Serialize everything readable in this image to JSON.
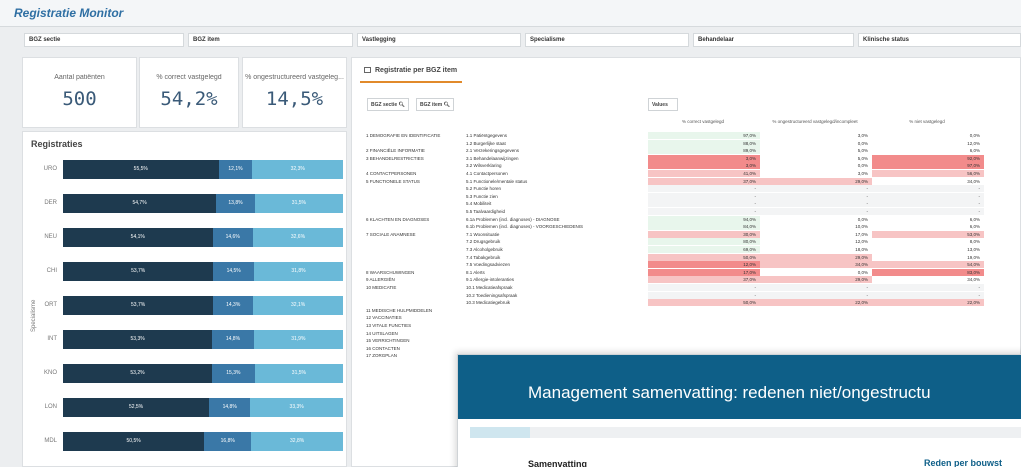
{
  "app": {
    "title": "Registratie Monitor"
  },
  "filters": [
    "BGZ sectie",
    "BGZ item",
    "Vastlegging",
    "Specialisme",
    "Behandelaar",
    "Klinische status"
  ],
  "kpis": [
    {
      "label": "Aantal patiënten",
      "value": "500"
    },
    {
      "label": "% correct vastgelegd",
      "value": "54,2%"
    },
    {
      "label": "% ongestructureerd vastgeleg...",
      "value": "14,5%"
    }
  ],
  "registraties": {
    "title": "Registraties",
    "axis_label": "Specialisme",
    "rows": [
      {
        "cat": "URO",
        "v1": "55,5%",
        "v2": "12,1%",
        "v3": "32,3%"
      },
      {
        "cat": "DER",
        "v1": "54,7%",
        "v2": "13,8%",
        "v3": "31,5%"
      },
      {
        "cat": "NEU",
        "v1": "54,1%",
        "v2": "14,6%",
        "v3": "32,6%"
      },
      {
        "cat": "CHI",
        "v1": "53,7%",
        "v2": "14,5%",
        "v3": "31,8%"
      },
      {
        "cat": "ORT",
        "v1": "53,7%",
        "v2": "14,3%",
        "v3": "32,1%"
      },
      {
        "cat": "INT",
        "v1": "53,3%",
        "v2": "14,8%",
        "v3": "31,9%"
      },
      {
        "cat": "KNO",
        "v1": "53,2%",
        "v2": "15,3%",
        "v3": "31,5%"
      },
      {
        "cat": "LON",
        "v1": "52,5%",
        "v2": "14,8%",
        "v3": "33,3%"
      },
      {
        "cat": "MDL",
        "v1": "50,5%",
        "v2": "16,8%",
        "v3": "32,8%"
      }
    ]
  },
  "table": {
    "tab_title": "Registratie per BGZ item",
    "dim_buttons": [
      "BGZ sectie",
      "BGZ item"
    ],
    "values_label": "Values",
    "col_headers": [
      "% correct vastgelegd",
      "% ongestructureerd vastgelegd/incompleet",
      "% niet vastgelegd"
    ],
    "rows": [
      {
        "s": "1 DEMOGRAFIE EN IDENTIFICATIE",
        "i": "1.1 Patiëntgegevens",
        "a": "97,0%",
        "b": "3,0%",
        "c": "0,0%",
        "ca": "#e8f6ec",
        "cb": "#ffffff",
        "cc": "#ffffff"
      },
      {
        "s": "",
        "i": "1.2 Burgerlijke staat",
        "a": "88,0%",
        "b": "0,0%",
        "c": "12,0%",
        "ca": "#e8f6ec",
        "cb": "#ffffff",
        "cc": "#ffffff"
      },
      {
        "s": "2 FINANCIËLE INFORMATIE",
        "i": "2.1 Verzekeringsgegevens",
        "a": "89,0%",
        "b": "5,0%",
        "c": "6,0%",
        "ca": "#e8f6ec",
        "cb": "#ffffff",
        "cc": "#ffffff"
      },
      {
        "s": "3 BEHANDELRESTRICTIES",
        "i": "3.1 Behandelaanwijzingen",
        "a": "3,0%",
        "b": "5,0%",
        "c": "92,0%",
        "ca": "#f28b8b",
        "cb": "#ffffff",
        "cc": "#f28b8b"
      },
      {
        "s": "",
        "i": "3.2 Wilsverklaring",
        "a": "3,0%",
        "b": "0,0%",
        "c": "97,0%",
        "ca": "#f28b8b",
        "cb": "#ffffff",
        "cc": "#f28b8b"
      },
      {
        "s": "4 CONTACTPERSONEN",
        "i": "4.1 Contactpersonen",
        "a": "41,0%",
        "b": "3,0%",
        "c": "56,0%",
        "ca": "#f7c4c4",
        "cb": "#ffffff",
        "cc": "#f7c4c4"
      },
      {
        "s": "5 FUNCTIONELE STATUS",
        "i": "5.1 Functionele/mentale status",
        "a": "37,0%",
        "b": "29,0%",
        "c": "34,0%",
        "ca": "#f7c4c4",
        "cb": "#f7c4c4",
        "cc": "#ffffff"
      },
      {
        "s": "",
        "i": "5.2 Functie horen",
        "a": "-",
        "b": "-",
        "c": "-",
        "ca": "#f3f4f5",
        "cb": "#f3f4f5",
        "cc": "#f3f4f5"
      },
      {
        "s": "",
        "i": "5.3 Functie zien",
        "a": "-",
        "b": "-",
        "c": "-",
        "ca": "#f3f4f5",
        "cb": "#f3f4f5",
        "cc": "#f3f4f5"
      },
      {
        "s": "",
        "i": "5.4 Mobiliteit",
        "a": "-",
        "b": "-",
        "c": "-",
        "ca": "#f3f4f5",
        "cb": "#f3f4f5",
        "cc": "#f3f4f5"
      },
      {
        "s": "",
        "i": "5.5 Taalvaardigheid",
        "a": "-",
        "b": "-",
        "c": "-",
        "ca": "#f3f4f5",
        "cb": "#f3f4f5",
        "cc": "#f3f4f5"
      },
      {
        "s": "6 KLACHTEN EN DIAGNOSES",
        "i": "6.1a Problemen (incl. diagnoses) - DIAGNOSE",
        "a": "94,0%",
        "b": "0,0%",
        "c": "6,0%",
        "ca": "#e8f6ec",
        "cb": "#ffffff",
        "cc": "#ffffff"
      },
      {
        "s": "",
        "i": "6.1b Problemen (incl. diagnoses) - VOORGESCHIEDENIS",
        "a": "84,0%",
        "b": "10,0%",
        "c": "6,0%",
        "ca": "#e8f6ec",
        "cb": "#ffffff",
        "cc": "#ffffff"
      },
      {
        "s": "7 SOCIALE ANAMNESE",
        "i": "7.1 Woonsituatie",
        "a": "30,0%",
        "b": "17,0%",
        "c": "53,0%",
        "ca": "#f7c4c4",
        "cb": "#ffffff",
        "cc": "#f7c4c4"
      },
      {
        "s": "",
        "i": "7.2 Drugsgebruik",
        "a": "80,0%",
        "b": "12,0%",
        "c": "8,0%",
        "ca": "#e8f6ec",
        "cb": "#ffffff",
        "cc": "#ffffff"
      },
      {
        "s": "",
        "i": "7.3 Alcoholgebruik",
        "a": "69,0%",
        "b": "18,0%",
        "c": "13,0%",
        "ca": "#e8f6ec",
        "cb": "#ffffff",
        "cc": "#ffffff"
      },
      {
        "s": "",
        "i": "7.4 Tabakgebruik",
        "a": "50,0%",
        "b": "29,0%",
        "c": "19,0%",
        "ca": "#f7c4c4",
        "cb": "#f7c4c4",
        "cc": "#ffffff"
      },
      {
        "s": "",
        "i": "7.5 Voedingsadviezen",
        "a": "12,0%",
        "b": "34,0%",
        "c": "54,0%",
        "ca": "#f28b8b",
        "cb": "#f7c4c4",
        "cc": "#f7c4c4"
      },
      {
        "s": "8 WAARSCHUWINGEN",
        "i": "8.1 Alerts",
        "a": "17,0%",
        "b": "0,0%",
        "c": "83,0%",
        "ca": "#f28b8b",
        "cb": "#ffffff",
        "cc": "#f28b8b"
      },
      {
        "s": "9 ALLERGIËN",
        "i": "9.1 Allergie-intoleranties",
        "a": "37,0%",
        "b": "29,0%",
        "c": "34,0%",
        "ca": "#f7c4c4",
        "cb": "#f7c4c4",
        "cc": "#ffffff"
      },
      {
        "s": "10 MEDICATIE",
        "i": "10.1 Medicatieafspraak",
        "a": "-",
        "b": "-",
        "c": "-",
        "ca": "#f3f4f5",
        "cb": "#f3f4f5",
        "cc": "#f3f4f5"
      },
      {
        "s": "",
        "i": "10.2 Toedieningsafspraak",
        "a": "-",
        "b": "-",
        "c": "-",
        "ca": "#f3f4f5",
        "cb": "#f3f4f5",
        "cc": "#f3f4f5"
      },
      {
        "s": "",
        "i": "10.3 Medicatiegebruik",
        "a": "50,0%",
        "b": "22,0%",
        "c": "22,0%",
        "ca": "#f7c4c4",
        "cb": "#f7c4c4",
        "cc": "#f7c4c4"
      },
      {
        "s": "11 MEDISCHE HULPMIDDELEN",
        "i": "",
        "a": "",
        "b": "",
        "c": "",
        "ca": "#ffffff",
        "cb": "#ffffff",
        "cc": "#ffffff"
      },
      {
        "s": "12 VACCINATIES",
        "i": "",
        "a": "",
        "b": "",
        "c": "",
        "ca": "#ffffff",
        "cb": "#ffffff",
        "cc": "#ffffff"
      },
      {
        "s": "13 VITALE FUNCTIES",
        "i": "",
        "a": "",
        "b": "",
        "c": "",
        "ca": "#ffffff",
        "cb": "#ffffff",
        "cc": "#ffffff"
      },
      {
        "s": "14 UITSLAGEN",
        "i": "",
        "a": "",
        "b": "",
        "c": "",
        "ca": "#ffffff",
        "cb": "#ffffff",
        "cc": "#ffffff"
      },
      {
        "s": "15 VERRICHTINGEN",
        "i": "",
        "a": "",
        "b": "",
        "c": "",
        "ca": "#ffffff",
        "cb": "#ffffff",
        "cc": "#ffffff"
      },
      {
        "s": "16 CONTACTEN",
        "i": "",
        "a": "",
        "b": "",
        "c": "",
        "ca": "#ffffff",
        "cb": "#ffffff",
        "cc": "#ffffff"
      },
      {
        "s": "17 ZORGPLAN",
        "i": "",
        "a": "",
        "b": "",
        "c": "",
        "ca": "#ffffff",
        "cb": "#ffffff",
        "cc": "#ffffff"
      }
    ]
  },
  "overlay": {
    "title": "Management samenvatting: redenen niet/ongestructu",
    "summary": "Samenvatting",
    "reason": "Reden per bouwst"
  }
}
